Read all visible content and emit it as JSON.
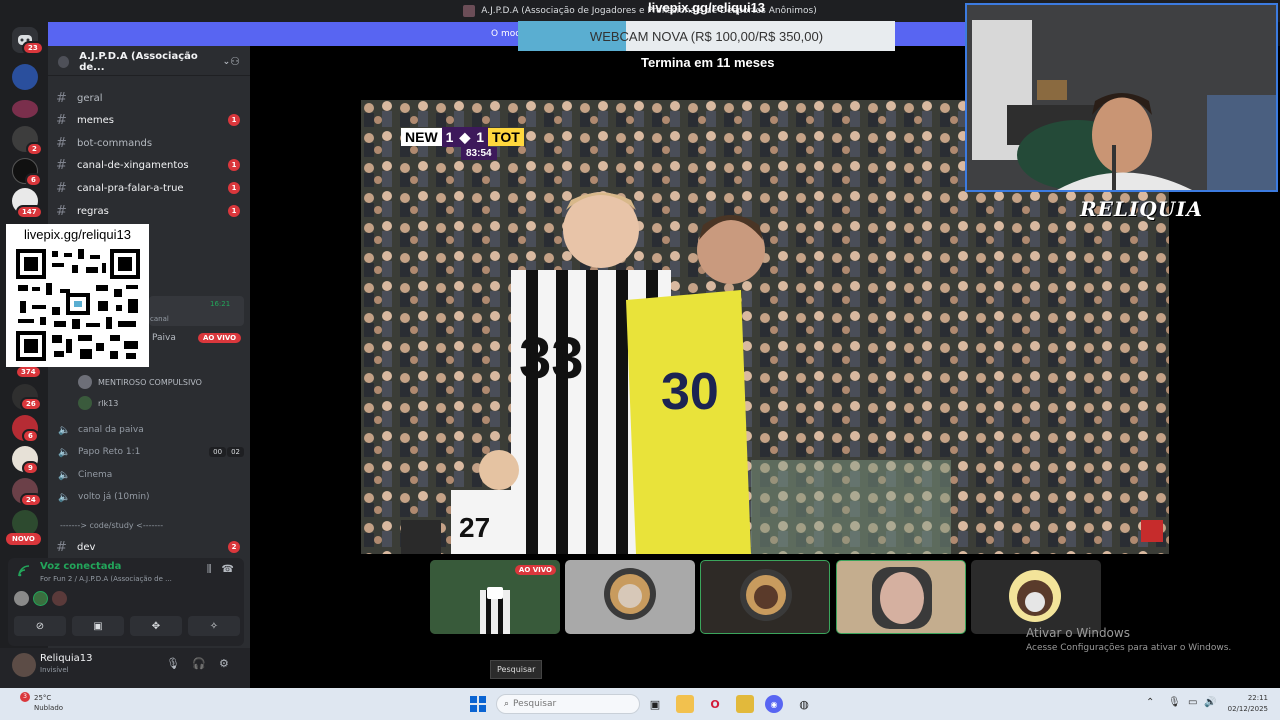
{
  "window": {
    "title": "A.J.P.D.A (Associação de Jogadores e Profissionais de Desportos Anônimos)"
  },
  "rail": {
    "badges": [
      "23",
      "2",
      "6",
      "147",
      "374",
      "26",
      "6",
      "9",
      "24"
    ],
    "novo_label": "NOVO"
  },
  "banner": {
    "text": "O mod"
  },
  "guild": {
    "name": "A.J.P.D.A (Associação de..."
  },
  "channels": [
    {
      "name": "geral",
      "unread": ""
    },
    {
      "name": "memes",
      "unread": "1"
    },
    {
      "name": "bot-commands",
      "unread": ""
    },
    {
      "name": "canal-de-xingamentos",
      "unread": "1"
    },
    {
      "name": "canal-pra-falar-a-true",
      "unread": "1"
    },
    {
      "name": "regras",
      "unread": "1"
    }
  ],
  "qr": {
    "title": "livepix.gg/reliqui13"
  },
  "partial": {
    "time": "16:21",
    "canal_snippet": "canal",
    "paiva_snippet": "Paiva",
    "live_label": "AO VIVO"
  },
  "voice_users": [
    {
      "name": "MENTIROSO COMPULSIVO"
    },
    {
      "name": "rlk13"
    }
  ],
  "voice_channels": [
    {
      "name": "canal da paiva",
      "count_a": "",
      "count_b": ""
    },
    {
      "name": "Papo Reto 1:1",
      "count_a": "00",
      "count_b": "02"
    },
    {
      "name": "Cinema",
      "count_a": "",
      "count_b": ""
    },
    {
      "name": "volto já (10min)",
      "count_a": "",
      "count_b": ""
    }
  ],
  "category_code": "-------> code/study <-------",
  "dev_channel": {
    "name": "dev",
    "unread": "2"
  },
  "voice_panel": {
    "status": "Voz conectada",
    "location": "For Fun 2 / A.J.P.D.A (Associação de ..."
  },
  "user": {
    "name": "Reliquia13",
    "status": "Invisível"
  },
  "stream": {
    "promo_url": "livepix.gg/reliqui13",
    "promo_text": "WEBCAM NOVA (R$ 100,00/R$ 350,00)",
    "promo_progress": 0.286,
    "promo_end": "Termina em 11 meses",
    "webcam_label": "RELIQUIA"
  },
  "scoreboard": {
    "home": "NEW",
    "home_score": "1",
    "away_score": "1",
    "away": "TOT",
    "clock": "83:54"
  },
  "jersey_numbers": [
    "33",
    "27",
    "30"
  ],
  "tiles": [
    {
      "live": "AO VIVO"
    }
  ],
  "windows_activation": {
    "title": "Ativar o Windows",
    "subtitle": "Acesse Configurações para ativar o Windows."
  },
  "tooltip": "Pesquisar",
  "taskbar": {
    "weather_temp": "25°C",
    "weather_cond": "Nublado",
    "weather_badge": "3",
    "search_placeholder": "Pesquisar",
    "time": "22:11",
    "date": "02/12/2025"
  }
}
